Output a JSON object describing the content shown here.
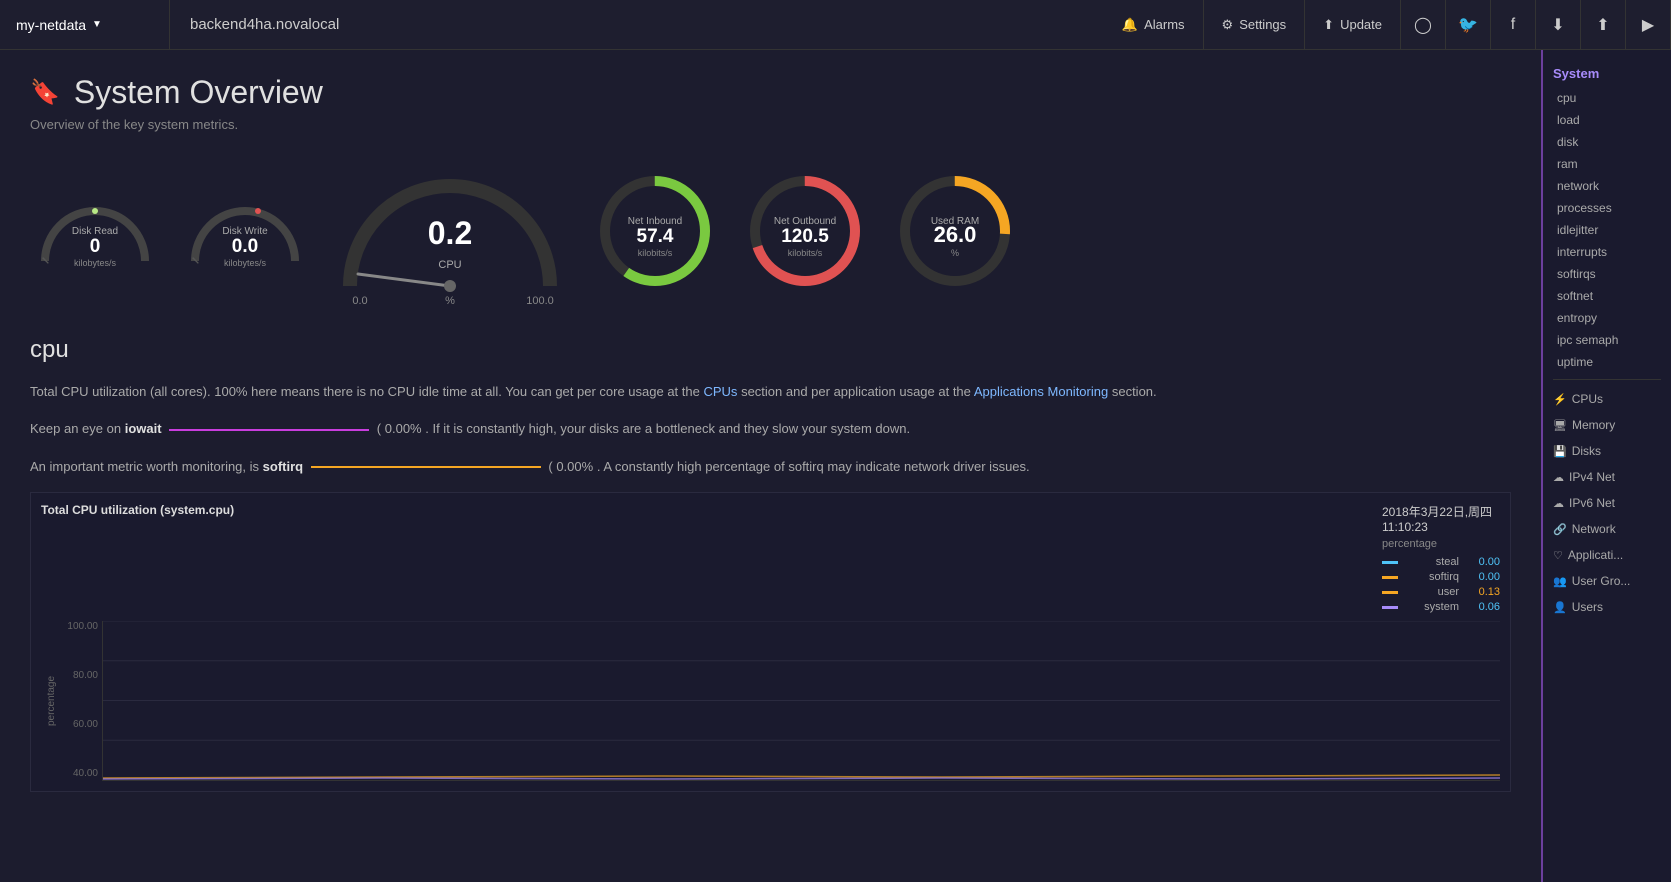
{
  "topnav": {
    "brand": "my-netdata",
    "host": "backend4ha.novalocal",
    "alarms": "Alarms",
    "settings": "Settings",
    "update": "Update"
  },
  "page": {
    "title": "System Overview",
    "subtitle": "Overview of the key system metrics.",
    "icon": "🔖"
  },
  "gauges": {
    "disk_read": {
      "label": "Disk Read",
      "value": "0",
      "unit": "kilobytes/s",
      "dot_color": "#b8e986",
      "arc_color": "#555"
    },
    "disk_write": {
      "label": "Disk Write",
      "value": "0.0",
      "unit": "kilobytes/s",
      "dot_color": "#e05252",
      "arc_color": "#555"
    },
    "cpu": {
      "label": "CPU",
      "value": "0.2",
      "min": "0.0",
      "max": "100.0",
      "unit": "%"
    },
    "net_inbound": {
      "label": "Net Inbound",
      "value": "57.4",
      "unit": "kilobits/s",
      "arc_color": "#7ac940"
    },
    "net_outbound": {
      "label": "Net Outbound",
      "value": "120.5",
      "unit": "kilobits/s",
      "arc_color": "#e05252"
    },
    "used_ram": {
      "label": "Used RAM",
      "value": "26.0",
      "unit": "%",
      "arc_color": "#f5a623"
    }
  },
  "section_cpu": {
    "title": "cpu",
    "description1": "Total CPU utilization (all cores). 100% here means there is no CPU idle time at all. You can get per core usage at the",
    "cpus_link": "CPUs",
    "description2": "section and per application usage at the",
    "apps_link": "Applications Monitoring",
    "description3": "section.",
    "iowait_text": "Keep an eye on",
    "iowait_strong": "iowait",
    "iowait_value": "0.00%",
    "iowait_desc": ". If it is constantly high, your disks are a bottleneck and they slow your system down.",
    "softirq_text": "An important metric worth monitoring, is",
    "softirq_strong": "softirq",
    "softirq_value": "0.00%",
    "softirq_desc": ". A constantly high percentage of softirq may indicate network driver issues."
  },
  "chart": {
    "title": "Total CPU utilization (system.cpu)",
    "datetime_line1": "2018年3月22日,周四",
    "datetime_line2": "11:10:23",
    "percentage_label": "percentage",
    "y_labels": [
      "100.00",
      "80.00",
      "60.00",
      "40.00"
    ],
    "y_side_label": "percentage",
    "legend": [
      {
        "name": "steal",
        "color": "#4fc3f7",
        "value": "0.00"
      },
      {
        "name": "softirq",
        "color": "#f5a623",
        "value": "0.00"
      },
      {
        "name": "user",
        "color": "#f5a623",
        "value": "0.13"
      },
      {
        "name": "system",
        "color": "#a78bfa",
        "value": "0.06"
      }
    ]
  },
  "sidebar": {
    "system_label": "System",
    "items": [
      "cpu",
      "load",
      "disk",
      "ram",
      "network",
      "processes",
      "idlejitter",
      "interrupts",
      "softirqs",
      "softnet",
      "entropy",
      "ipc semaph",
      "uptime"
    ],
    "groups": [
      {
        "icon": "⚡",
        "label": "CPUs"
      },
      {
        "icon": "🖥",
        "label": "Memory"
      },
      {
        "icon": "💾",
        "label": "Disks"
      },
      {
        "icon": "☁",
        "label": "IPv4 Net"
      },
      {
        "icon": "☁",
        "label": "IPv6 Net"
      },
      {
        "icon": "🔗",
        "label": "Network"
      },
      {
        "icon": "♡",
        "label": "Applicati..."
      },
      {
        "icon": "👥",
        "label": "User Gro..."
      },
      {
        "icon": "👤",
        "label": "Users"
      }
    ]
  }
}
